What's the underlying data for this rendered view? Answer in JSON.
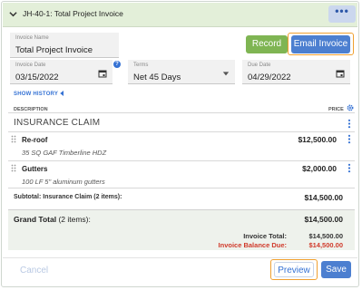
{
  "header": {
    "title": "JH-40-1: Total Project Invoice"
  },
  "invoice_name": {
    "label": "Invoice Name",
    "value": "Total Project Invoice"
  },
  "actions": {
    "record": "Record",
    "email": "Email Invoice"
  },
  "invoice_date": {
    "label": "Invoice Date",
    "value": "03/15/2022"
  },
  "terms": {
    "label": "Terms",
    "value": "Net 45 Days"
  },
  "due_date": {
    "label": "Due Date",
    "value": "04/29/2022"
  },
  "show_history": "SHOW HISTORY",
  "columns": {
    "description": "DESCRIPTION",
    "price": "PRICE"
  },
  "section": {
    "title": "INSURANCE CLAIM"
  },
  "items": [
    {
      "name": "Re-roof",
      "description": "35 SQ GAF Timberline HDZ",
      "price": "$12,500.00"
    },
    {
      "name": "Gutters",
      "description": "100 LF 5\" aluminum gutters",
      "price": "$2,000.00"
    }
  ],
  "subtotal": {
    "label": "Subtotal: Insurance Claim (2 items):",
    "value": "$14,500.00"
  },
  "grand_total": {
    "label": "Grand Total",
    "count": "(2 items):",
    "value": "$14,500.00"
  },
  "invoice_total": {
    "label": "Invoice Total:",
    "value": "$14,500.00"
  },
  "balance_due": {
    "label": "Invoice Balance Due:",
    "value": "$14,500.00"
  },
  "footer": {
    "cancel": "Cancel",
    "preview": "Preview",
    "save": "Save"
  },
  "colors": {
    "accent": "#4c7fd0",
    "record": "#7fb553",
    "highlight": "#f0a030",
    "balance": "#d03a2a",
    "header_bg": "#e3efd9"
  }
}
